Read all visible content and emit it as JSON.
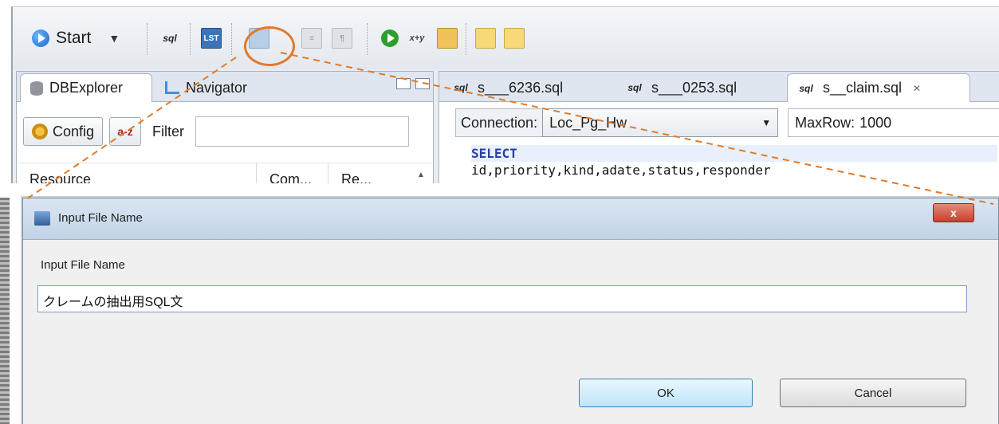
{
  "toolbar": {
    "start_label": "Start",
    "icons": [
      "play-circle-icon",
      "sql-icon",
      "save-list-icon",
      "save-icon",
      "format-icon",
      "paragraph-icon",
      "run-icon",
      "xy-icon",
      "document-icon",
      "swap-left-icon",
      "swap-right-icon"
    ]
  },
  "left_pane": {
    "tabs": [
      {
        "label": "DBExplorer",
        "icon": "database-icon"
      },
      {
        "label": "Navigator",
        "icon": "navigator-icon"
      }
    ],
    "config_label": "Config",
    "sort_icon_label": "a-z",
    "filter_label": "Filter",
    "filter_value": "",
    "columns": [
      "Resource",
      "Com...",
      "Re..."
    ]
  },
  "editor": {
    "tabs": [
      {
        "label": "s___6236.sql"
      },
      {
        "label": "s___0253.sql"
      },
      {
        "label": "s__claim.sql",
        "active": true
      }
    ],
    "connection_label": "Connection:",
    "connection_value": "Loc_Pg_Hw",
    "maxrow_label": "MaxRow:",
    "maxrow_value": "1000",
    "sql_keyword": "SELECT",
    "sql_line": "id,priority,kind,adate,status,responder"
  },
  "dialog": {
    "title": "Input File Name",
    "close_label": "x",
    "field_label": "Input File Name",
    "field_value": "クレームの抽出用SQL文",
    "ok_label": "OK",
    "cancel_label": "Cancel"
  },
  "colors": {
    "highlight": "#e07a2a",
    "sql_keyword": "#2a3ea8",
    "title_close": "#c3412d"
  }
}
